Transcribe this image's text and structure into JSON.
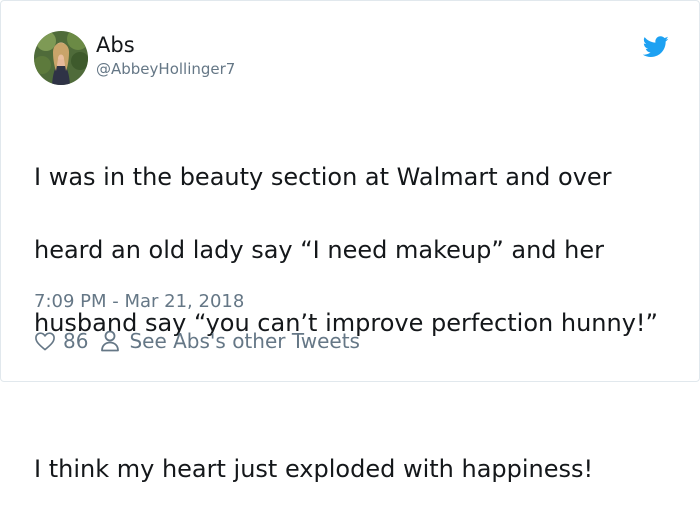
{
  "user": {
    "display_name": "Abs",
    "handle": "@AbbeyHollinger7"
  },
  "tweet": {
    "lines": [
      "I was in the beauty section at Walmart and over",
      "heard an old lady say “I need makeup” and her",
      "husband say “you can’t improve perfection hunny!”",
      "I think my heart just exploded with happiness!"
    ],
    "timestamp": "7:09 PM - Mar 21, 2018"
  },
  "actions": {
    "like_count": "86",
    "other_tweets_label": "See Abs's other Tweets"
  },
  "icons": {
    "like": "heart-icon",
    "profile": "person-icon",
    "brand": "twitter-bird-icon"
  },
  "colors": {
    "brand_blue": "#1da1f2",
    "text_primary": "#14171a",
    "text_secondary": "#657786",
    "border": "#e1e8ed"
  }
}
